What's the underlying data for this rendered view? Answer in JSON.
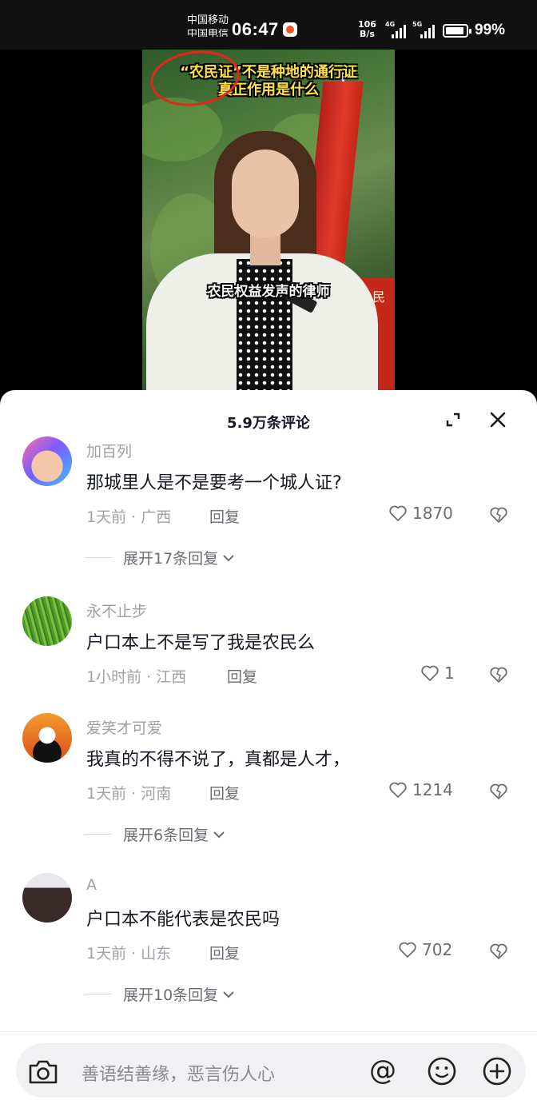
{
  "status": {
    "carrier1": "中国移动",
    "carrier2": "中国电信",
    "time": "06:47",
    "net_speed_top": "106",
    "net_speed_unit": "B/s",
    "net_type1": "4G",
    "net_type2": "5G",
    "battery": "99%"
  },
  "video": {
    "caption_line1": "“农民证”不是种地的通行证",
    "caption_line2": "真正作用是什么",
    "caption_bottom": "农民权益发声的律师"
  },
  "panel": {
    "title": "5.9万条评论"
  },
  "comments": [
    {
      "user": "加百列",
      "text": "那城里人是不是要考一个城人证?",
      "meta": "1天前 · 广西",
      "reply": "回复",
      "likes": "1870",
      "expand": "展开17条回复"
    },
    {
      "user": "永不止步",
      "text": "户口本上不是写了我是农民么",
      "meta": "1小时前 · 江西",
      "reply": "回复",
      "likes": "1",
      "expand": ""
    },
    {
      "user": "爱笑才可爱",
      "text": "我真的不得不说了，真都是人才，",
      "meta": "1天前 · 河南",
      "reply": "回复",
      "likes": "1214",
      "expand": "展开6条回复"
    },
    {
      "user": "A",
      "text": "户口本不能代表是农民吗",
      "meta": "1天前 · 山东",
      "reply": "回复",
      "likes": "702",
      "expand": "展开10条回复"
    }
  ],
  "input": {
    "placeholder": "善语结善缘，恶言伤人心",
    "at_symbol": "@"
  },
  "colors": {
    "caption_yellow": "#ffe14a",
    "annotation_red": "#e3261c",
    "text_primary": "#161823",
    "text_secondary": "#a0a0a6"
  }
}
